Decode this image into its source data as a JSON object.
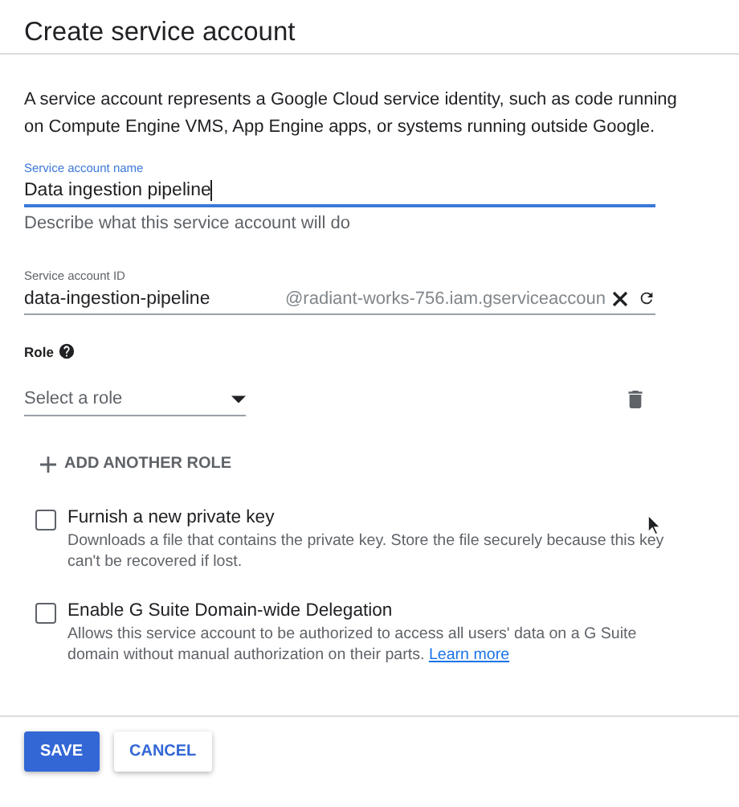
{
  "title": "Create service account",
  "intro": "A service account represents a Google Cloud service identity, such as code running on Compute Engine VMS, App Engine apps, or systems running outside Google.",
  "name_field": {
    "label": "Service account name",
    "value": "Data ingestion pipeline",
    "hint": "Describe what this service account will do",
    "focused": true
  },
  "id_field": {
    "label": "Service account ID",
    "value": "data-ingestion-pipeline",
    "suffix": "@radiant-works-756.iam.gserviceaccoun"
  },
  "role": {
    "label": "Role",
    "select_placeholder": "Select a role",
    "add_button": "ADD ANOTHER ROLE"
  },
  "options": [
    {
      "label": "Furnish a new private key",
      "description": "Downloads a file that contains the private key. Store the file securely because this key can't be recovered if lost.",
      "checked": false
    },
    {
      "label": "Enable G Suite Domain-wide Delegation",
      "description": "Allows this service account to be authorized to access all users' data on a G Suite domain without manual authorization on their parts.",
      "link": "Learn more",
      "checked": false
    }
  ],
  "buttons": [
    {
      "label": "SAVE",
      "kind": "primary"
    },
    {
      "label": "CANCEL",
      "kind": "secondary"
    }
  ]
}
